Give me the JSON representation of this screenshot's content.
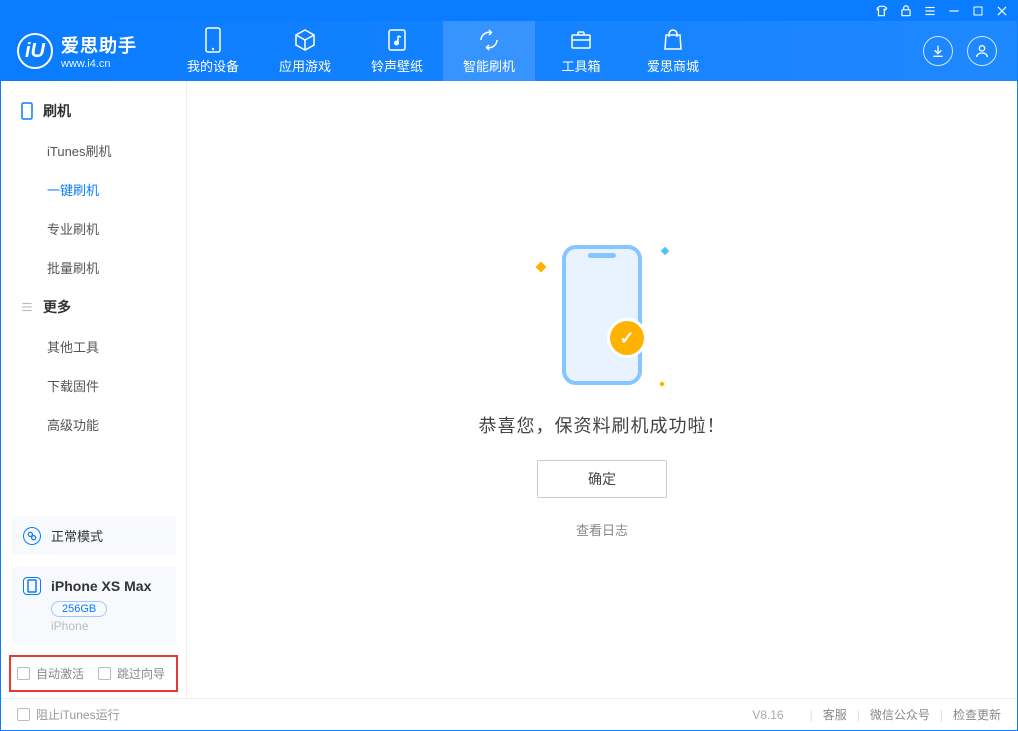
{
  "app": {
    "name": "爱思助手",
    "url": "www.i4.cn"
  },
  "nav": {
    "items": [
      {
        "label": "我的设备"
      },
      {
        "label": "应用游戏"
      },
      {
        "label": "铃声壁纸"
      },
      {
        "label": "智能刷机"
      },
      {
        "label": "工具箱"
      },
      {
        "label": "爱思商城"
      }
    ],
    "active_index": 3
  },
  "sidebar": {
    "group_flash": "刷机",
    "flash_items": [
      "iTunes刷机",
      "一键刷机",
      "专业刷机",
      "批量刷机"
    ],
    "flash_active_index": 1,
    "group_more": "更多",
    "more_items": [
      "其他工具",
      "下载固件",
      "高级功能"
    ],
    "mode_card": {
      "label": "正常模式"
    },
    "device": {
      "name": "iPhone XS Max",
      "capacity": "256GB",
      "type": "iPhone"
    },
    "options": {
      "auto_activate": "自动激活",
      "skip_guide": "跳过向导"
    }
  },
  "main": {
    "success_text": "恭喜您，保资料刷机成功啦！",
    "ok_button": "确定",
    "log_link": "查看日志"
  },
  "footer": {
    "block_itunes": "阻止iTunes运行",
    "version": "V8.16",
    "links": [
      "客服",
      "微信公众号",
      "检查更新"
    ]
  },
  "colors": {
    "primary": "#0a7cff",
    "accent": "#ffb300",
    "highlight_border": "#e53935"
  }
}
